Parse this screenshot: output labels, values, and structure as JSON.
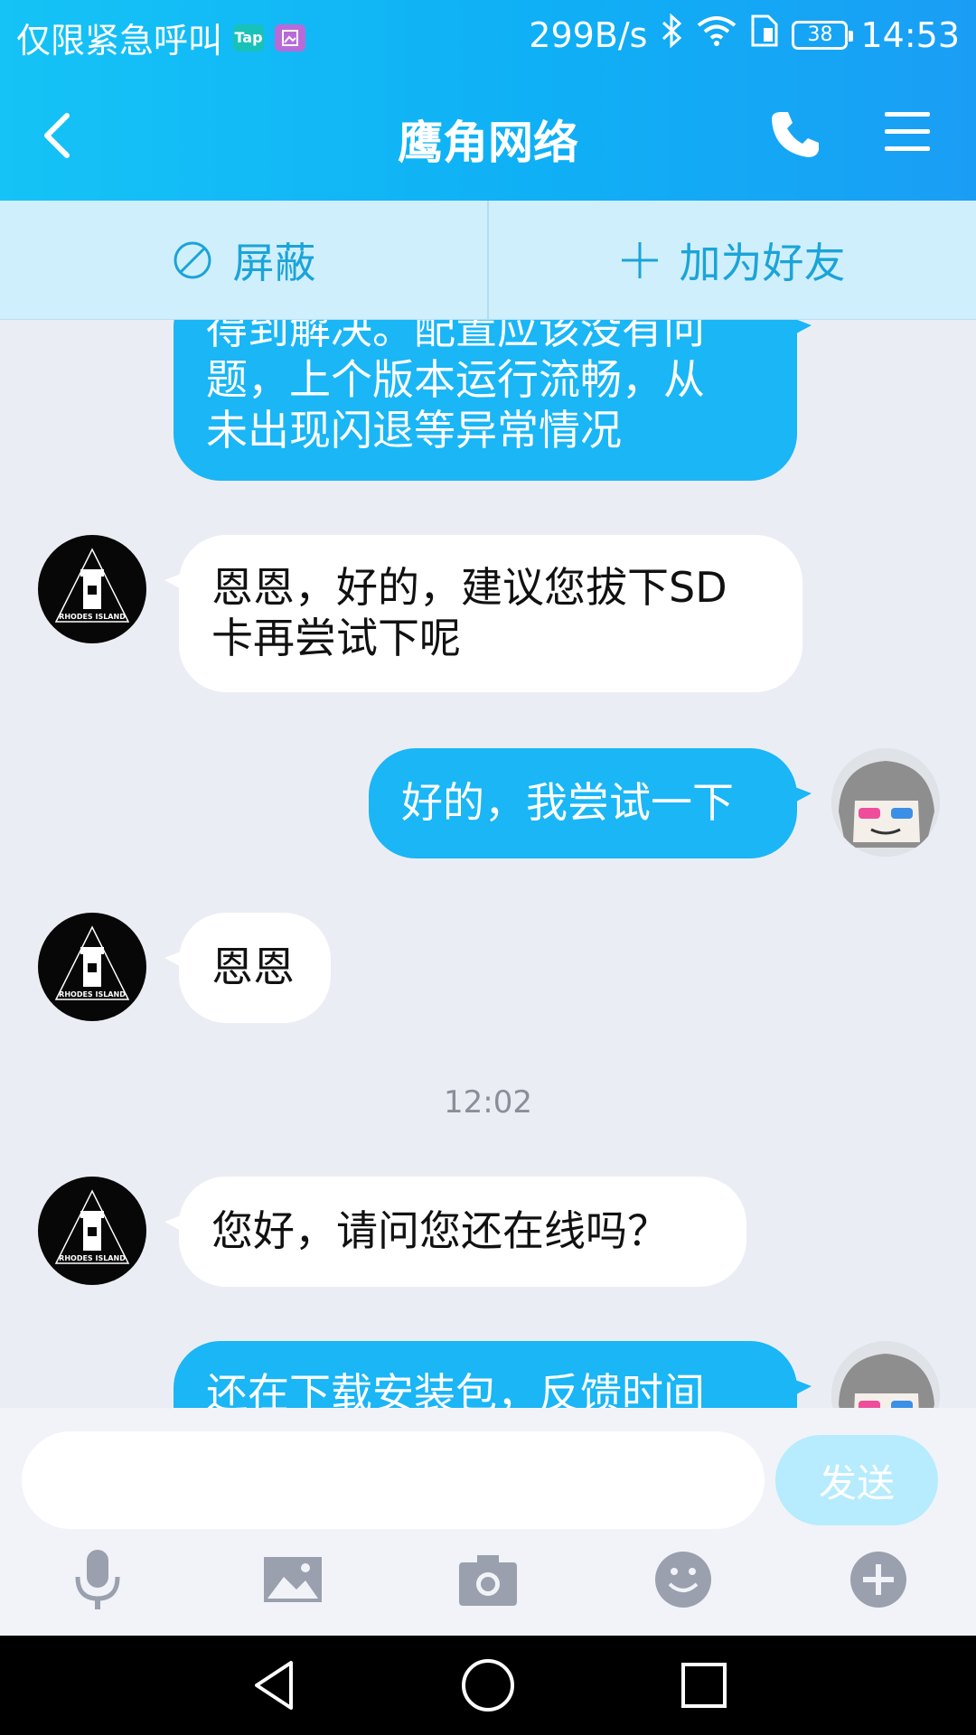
{
  "status_bar": {
    "carrier": "仅限紧急呼叫",
    "tap_badge": "Tap",
    "net_speed": "299B/s",
    "battery": "38",
    "time": "14:53"
  },
  "header": {
    "title": "鹰角网络",
    "icons": [
      "back-icon",
      "phone-icon",
      "menu-icon"
    ]
  },
  "actions": {
    "block_label": "屏蔽",
    "add_friend_label": "加为好友"
  },
  "messages": [
    {
      "from": "me",
      "lines": [
        "得到解决。配置应该没有问",
        "题，上个版本运行流畅，从",
        "未出现闪退等异常情况"
      ]
    },
    {
      "from": "other",
      "lines": [
        "恩恩，好的，建议您拔下SD",
        "卡再尝试下呢"
      ]
    },
    {
      "from": "me",
      "lines": [
        "好的，我尝试一下"
      ]
    },
    {
      "from": "other",
      "lines": [
        "恩恩"
      ]
    },
    {
      "from": "other",
      "lines": [
        "您好，请问您还在线吗？"
      ]
    },
    {
      "from": "me",
      "lines": [
        "还在下载安装包，反馈时间"
      ]
    }
  ],
  "timestamp": "12:02",
  "avatar_brand": "RHODES ISLAND",
  "input": {
    "placeholder": "",
    "send_label": "发送",
    "tools": [
      "microphone-icon",
      "image-icon",
      "camera-icon",
      "emoji-icon",
      "plus-icon"
    ]
  },
  "colors": {
    "header": "#15c3f6",
    "bubble_out": "#1ab6f6",
    "action_text": "#1ba4d8",
    "send_disabled": "#b6ecfd"
  }
}
